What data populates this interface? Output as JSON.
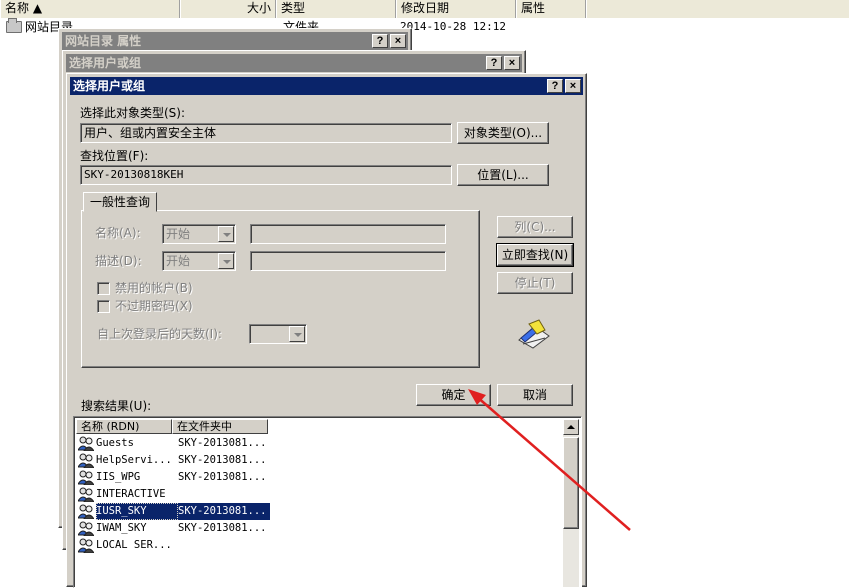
{
  "explorer": {
    "columns": {
      "name": "名称 ▲",
      "size": "大小",
      "type": "类型",
      "modified": "修改日期",
      "attributes": "属性"
    },
    "row": {
      "name": "网站目录",
      "type": "文件夹",
      "modified": "2014-10-28 12:12"
    }
  },
  "properties_window": {
    "title": "网站目录 属性",
    "help": "?",
    "close": "×"
  },
  "select_window_back": {
    "title": "选择用户或组",
    "help": "?",
    "close": "×"
  },
  "dialog": {
    "title": "选择用户或组",
    "help": "?",
    "close": "×",
    "object_type_label": "选择此对象类型(S):",
    "object_type_value": "用户、组或内置安全主体",
    "object_type_button": "对象类型(O)...",
    "location_label": "查找位置(F):",
    "location_value": "SKY-20130818KEH",
    "location_button": "位置(L)...",
    "tab_general": "一般性查询",
    "name_label": "名称(A):",
    "name_combo": "开始",
    "desc_label": "描述(D):",
    "desc_combo": "开始",
    "disabled_accounts": "禁用的帐户(B)",
    "non_expiring_pw": "不过期密码(X)",
    "days_since_logon": "自上次登录后的天数(I):",
    "columns_button": "列(C)...",
    "find_now_button": "立即查找(N)",
    "stop_button": "停止(T)",
    "ok_button": "确定",
    "cancel_button": "取消",
    "results_label": "搜索结果(U):",
    "results_columns": [
      "名称 (RDN)",
      "在文件夹中"
    ],
    "results": [
      {
        "name": "Guests",
        "folder": "SKY-2013081..."
      },
      {
        "name": "HelpServi...",
        "folder": "SKY-2013081..."
      },
      {
        "name": "IIS_WPG",
        "folder": "SKY-2013081..."
      },
      {
        "name": "INTERACTIVE",
        "folder": ""
      },
      {
        "name": "IUSR_SKY",
        "folder": "SKY-2013081..."
      },
      {
        "name": "IWAM_SKY",
        "folder": "SKY-2013081..."
      },
      {
        "name": "LOCAL SER...",
        "folder": ""
      }
    ],
    "selected_index": 4
  },
  "colors": {
    "active_title": "#0a246a",
    "inactive_title": "#808080",
    "face": "#d4d0c8",
    "annotation_arrow": "#e02020"
  },
  "icons": {
    "user": "user-group-icon",
    "search_flashlight": "search-flashlight-icon",
    "folder": "folder-icon"
  }
}
